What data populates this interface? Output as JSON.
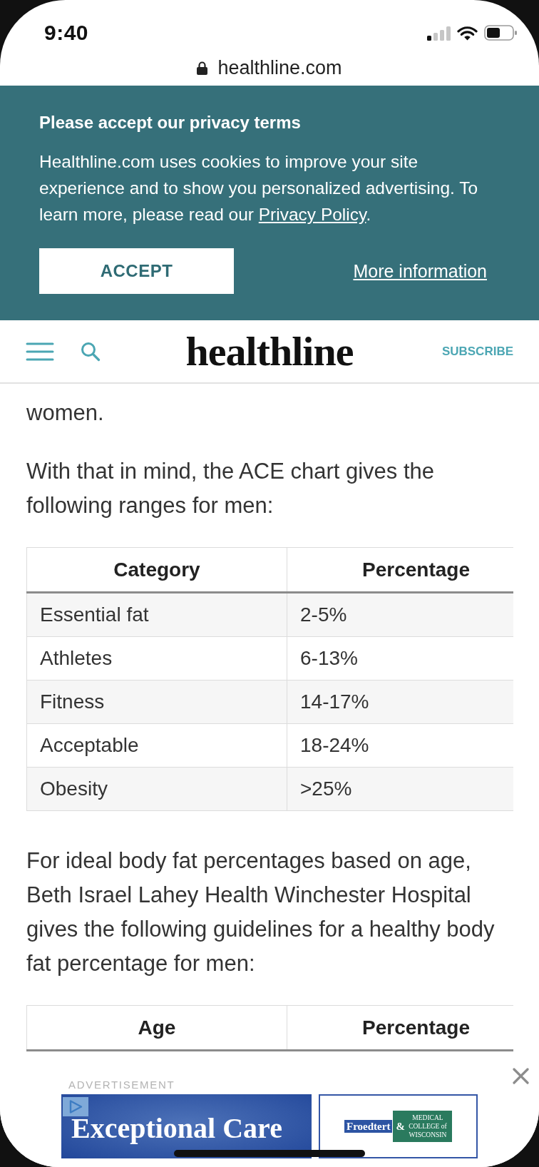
{
  "status_bar": {
    "time": "9:40"
  },
  "address_bar": {
    "url": "healthline.com"
  },
  "privacy_banner": {
    "title": "Please accept our privacy terms",
    "text": "Healthline.com uses cookies to improve your site experience and to show you personalized advertising. To learn more, please read our ",
    "link": "Privacy Policy",
    "text_end": ".",
    "accept_button": "ACCEPT",
    "more_link": "More information"
  },
  "header": {
    "logo": "healthline",
    "subscribe": "SUBSCRIBE"
  },
  "article": [
    {
      "kind": "paragraph",
      "text": "women."
    },
    {
      "kind": "paragraph",
      "text": "With that in mind, the ACE chart gives the following ranges for men:"
    },
    {
      "kind": "table",
      "columns": [
        "Category",
        "Percentage"
      ],
      "rows": [
        [
          "Essential fat",
          "2-5%"
        ],
        [
          "Athletes",
          "6-13%"
        ],
        [
          "Fitness",
          "14-17%"
        ],
        [
          "Acceptable",
          "18-24%"
        ],
        [
          "Obesity",
          ">25%"
        ]
      ]
    },
    {
      "kind": "paragraph",
      "text": "For ideal body fat percentages based on age, Beth Israel Lahey Health Winchester Hospital gives the following guidelines for a healthy body fat percentage for men:"
    },
    {
      "kind": "table",
      "columns": [
        "Age",
        "Percentage"
      ]
    }
  ],
  "ad": {
    "label": "ADVERTISEMENT",
    "headline": "Exceptional Care",
    "brand": "Froedtert",
    "joiner": "&",
    "partner": "MEDICAL COLLEGE of WISCONSIN"
  }
}
